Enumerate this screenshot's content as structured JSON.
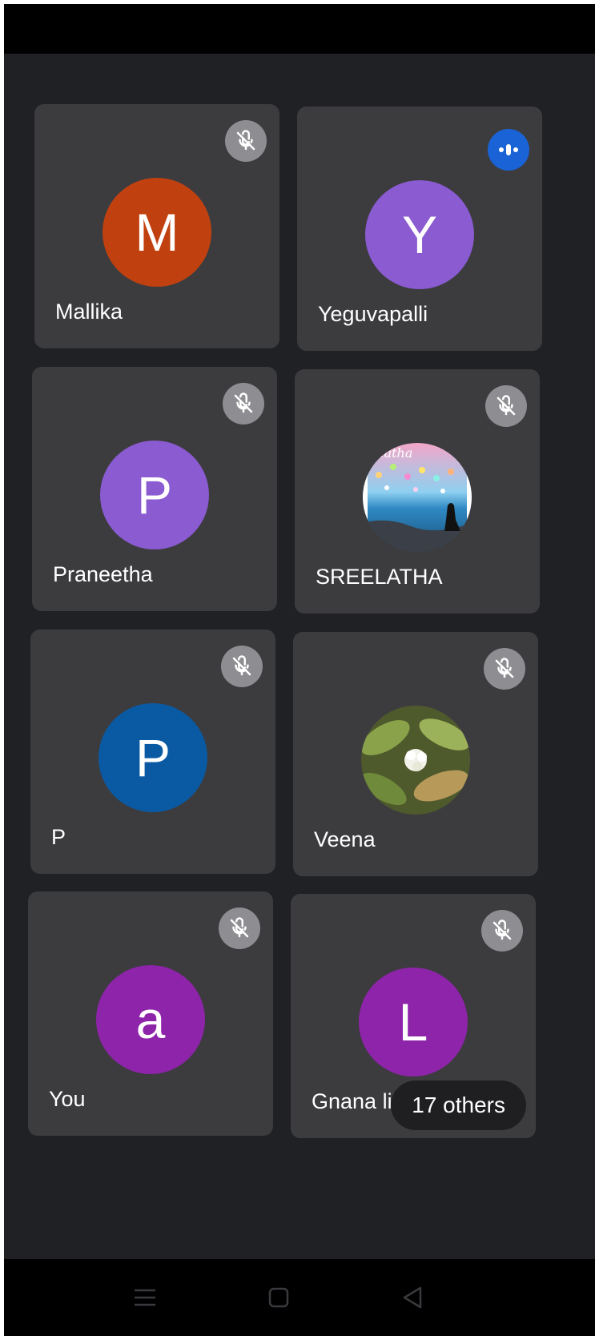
{
  "participants": [
    {
      "name": "Mallika",
      "initial": "M",
      "avatar_color": "#c0410f",
      "status": "muted"
    },
    {
      "name": "Yeguvapalli",
      "initial": "Y",
      "avatar_color": "#8a5bd1",
      "status": "speaking"
    },
    {
      "name": "Praneetha",
      "initial": "P",
      "avatar_color": "#8a5bd1",
      "status": "muted"
    },
    {
      "name": "SREELATHA",
      "initial": "",
      "avatar_color": "",
      "status": "muted",
      "photo": "sunset-beach-photo",
      "photo_caption": "elatha"
    },
    {
      "name": "P",
      "initial": "P",
      "avatar_color": "#0a5aa3",
      "status": "muted"
    },
    {
      "name": "Veena",
      "initial": "",
      "avatar_color": "",
      "status": "muted",
      "photo": "flower-leaves-photo"
    },
    {
      "name": "You",
      "initial": "a",
      "avatar_color": "#8e24aa",
      "status": "muted"
    },
    {
      "name": "Gnana li",
      "initial": "L",
      "avatar_color": "#8e24aa",
      "status": "muted"
    }
  ],
  "others_label": "17 others",
  "nav": {
    "icons": [
      "menu-icon",
      "home-square-icon",
      "back-triangle-icon"
    ]
  },
  "colors": {
    "background": "#202124",
    "tile": "#3c3c3f",
    "mic_badge": "#8e8e92",
    "speaking_badge": "#1a63d6"
  }
}
